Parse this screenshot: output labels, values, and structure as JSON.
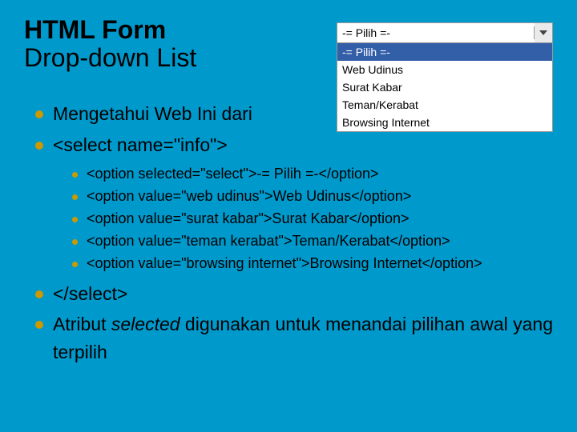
{
  "title": {
    "line1": "HTML Form",
    "line2": "Drop-down List"
  },
  "dropdown": {
    "selected": "-= Pilih =-",
    "options": [
      "-= Pilih =-",
      "Web Udinus",
      "Surat Kabar",
      "Teman/Kerabat",
      "Browsing Internet"
    ]
  },
  "bullets": {
    "b1": "Mengetahui Web Ini dari",
    "b2": "<select name=\"info\">",
    "nested": [
      "<option selected=\"select\">-= Pilih =-</option>",
      "<option value=\"web udinus\">Web Udinus</option>",
      "<option value=\"surat kabar\">Surat Kabar</option>",
      "<option value=\"teman kerabat\">Teman/Kerabat</option>",
      "<option value=\"browsing internet\">Browsing Internet</option>"
    ],
    "b3": "</select>",
    "b4_pre": "Atribut ",
    "b4_em": "selected",
    "b4_post": " digunakan untuk menandai pilihan awal yang terpilih"
  }
}
